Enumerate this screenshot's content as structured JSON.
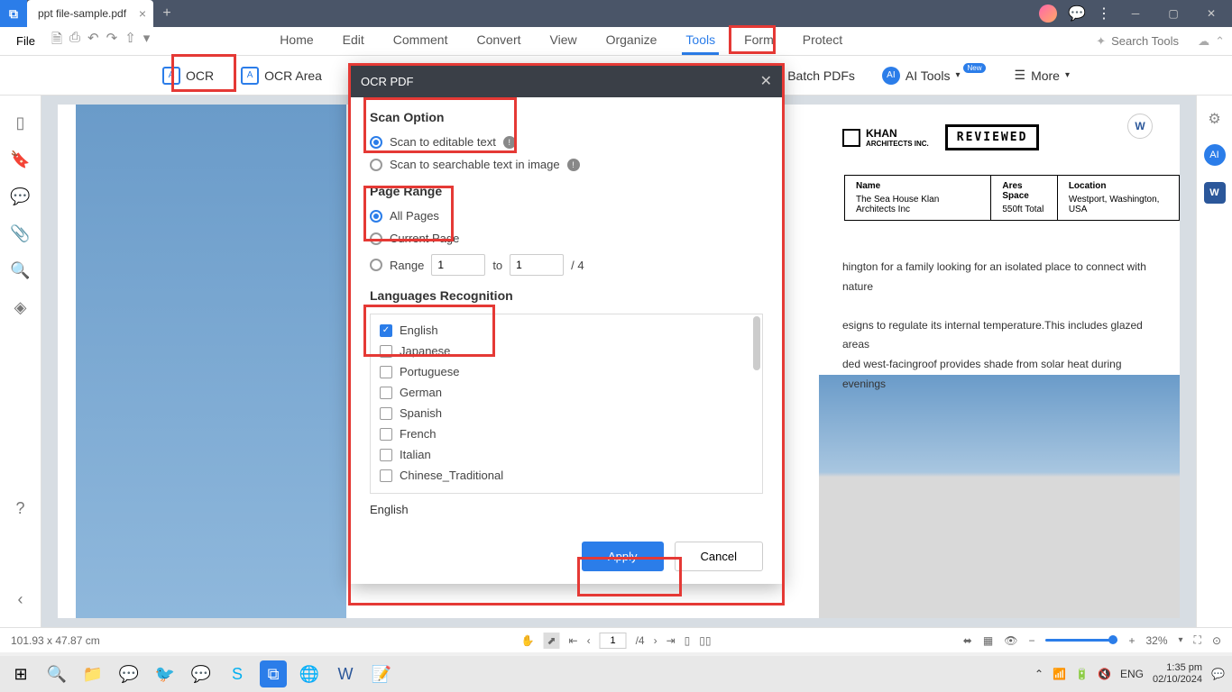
{
  "titlebar": {
    "tab_title": "ppt file-sample.pdf"
  },
  "menubar": {
    "file": "File"
  },
  "main_tabs": [
    "Home",
    "Edit",
    "Comment",
    "Convert",
    "View",
    "Organize",
    "Tools",
    "Form",
    "Protect"
  ],
  "active_tab": "Tools",
  "search_placeholder": "Search Tools",
  "toolbar": {
    "ocr": "OCR",
    "ocr_area": "OCR Area",
    "batch": "Batch PDFs",
    "ai": "AI Tools",
    "new_badge": "New",
    "more": "More"
  },
  "dialog": {
    "title": "OCR PDF",
    "scan_option_title": "Scan Option",
    "scan_editable": "Scan to editable text",
    "scan_searchable": "Scan to searchable text in image",
    "page_range_title": "Page Range",
    "all_pages": "All Pages",
    "current_page": "Current Page",
    "range_label": "Range",
    "range_from": "1",
    "range_to_label": "to",
    "range_to": "1",
    "range_total": "/ 4",
    "lang_title": "Languages Recognition",
    "languages": [
      "English",
      "Japanese",
      "Portuguese",
      "German",
      "Spanish",
      "French",
      "Italian",
      "Chinese_Traditional"
    ],
    "selected_lang": "English",
    "apply": "Apply",
    "cancel": "Cancel"
  },
  "document": {
    "company": "KHAN",
    "company_sub": "ARCHITECTS INC.",
    "reviewed": "REVIEWED",
    "col1_label": "Name",
    "col1_val": "The Sea House Klan Architects Inc",
    "col2_label": "Ares Space",
    "col2_val": "550ft Total",
    "col3_label": "Location",
    "col3_val": "Westport, Washington, USA",
    "para1": "hington for a family looking for an isolated place to connect with nature",
    "para2": "esigns to regulate its internal temperature.This includes glazed areas",
    "para3": "ded west-facingroof provides shade from solar heat during evenings"
  },
  "status": {
    "dims": "101.93 x 47.87 cm",
    "page_current": "1",
    "page_total": "/4",
    "zoom": "32%"
  },
  "systray": {
    "lang": "ENG",
    "time": "1:35 pm",
    "date": "02/10/2024"
  }
}
